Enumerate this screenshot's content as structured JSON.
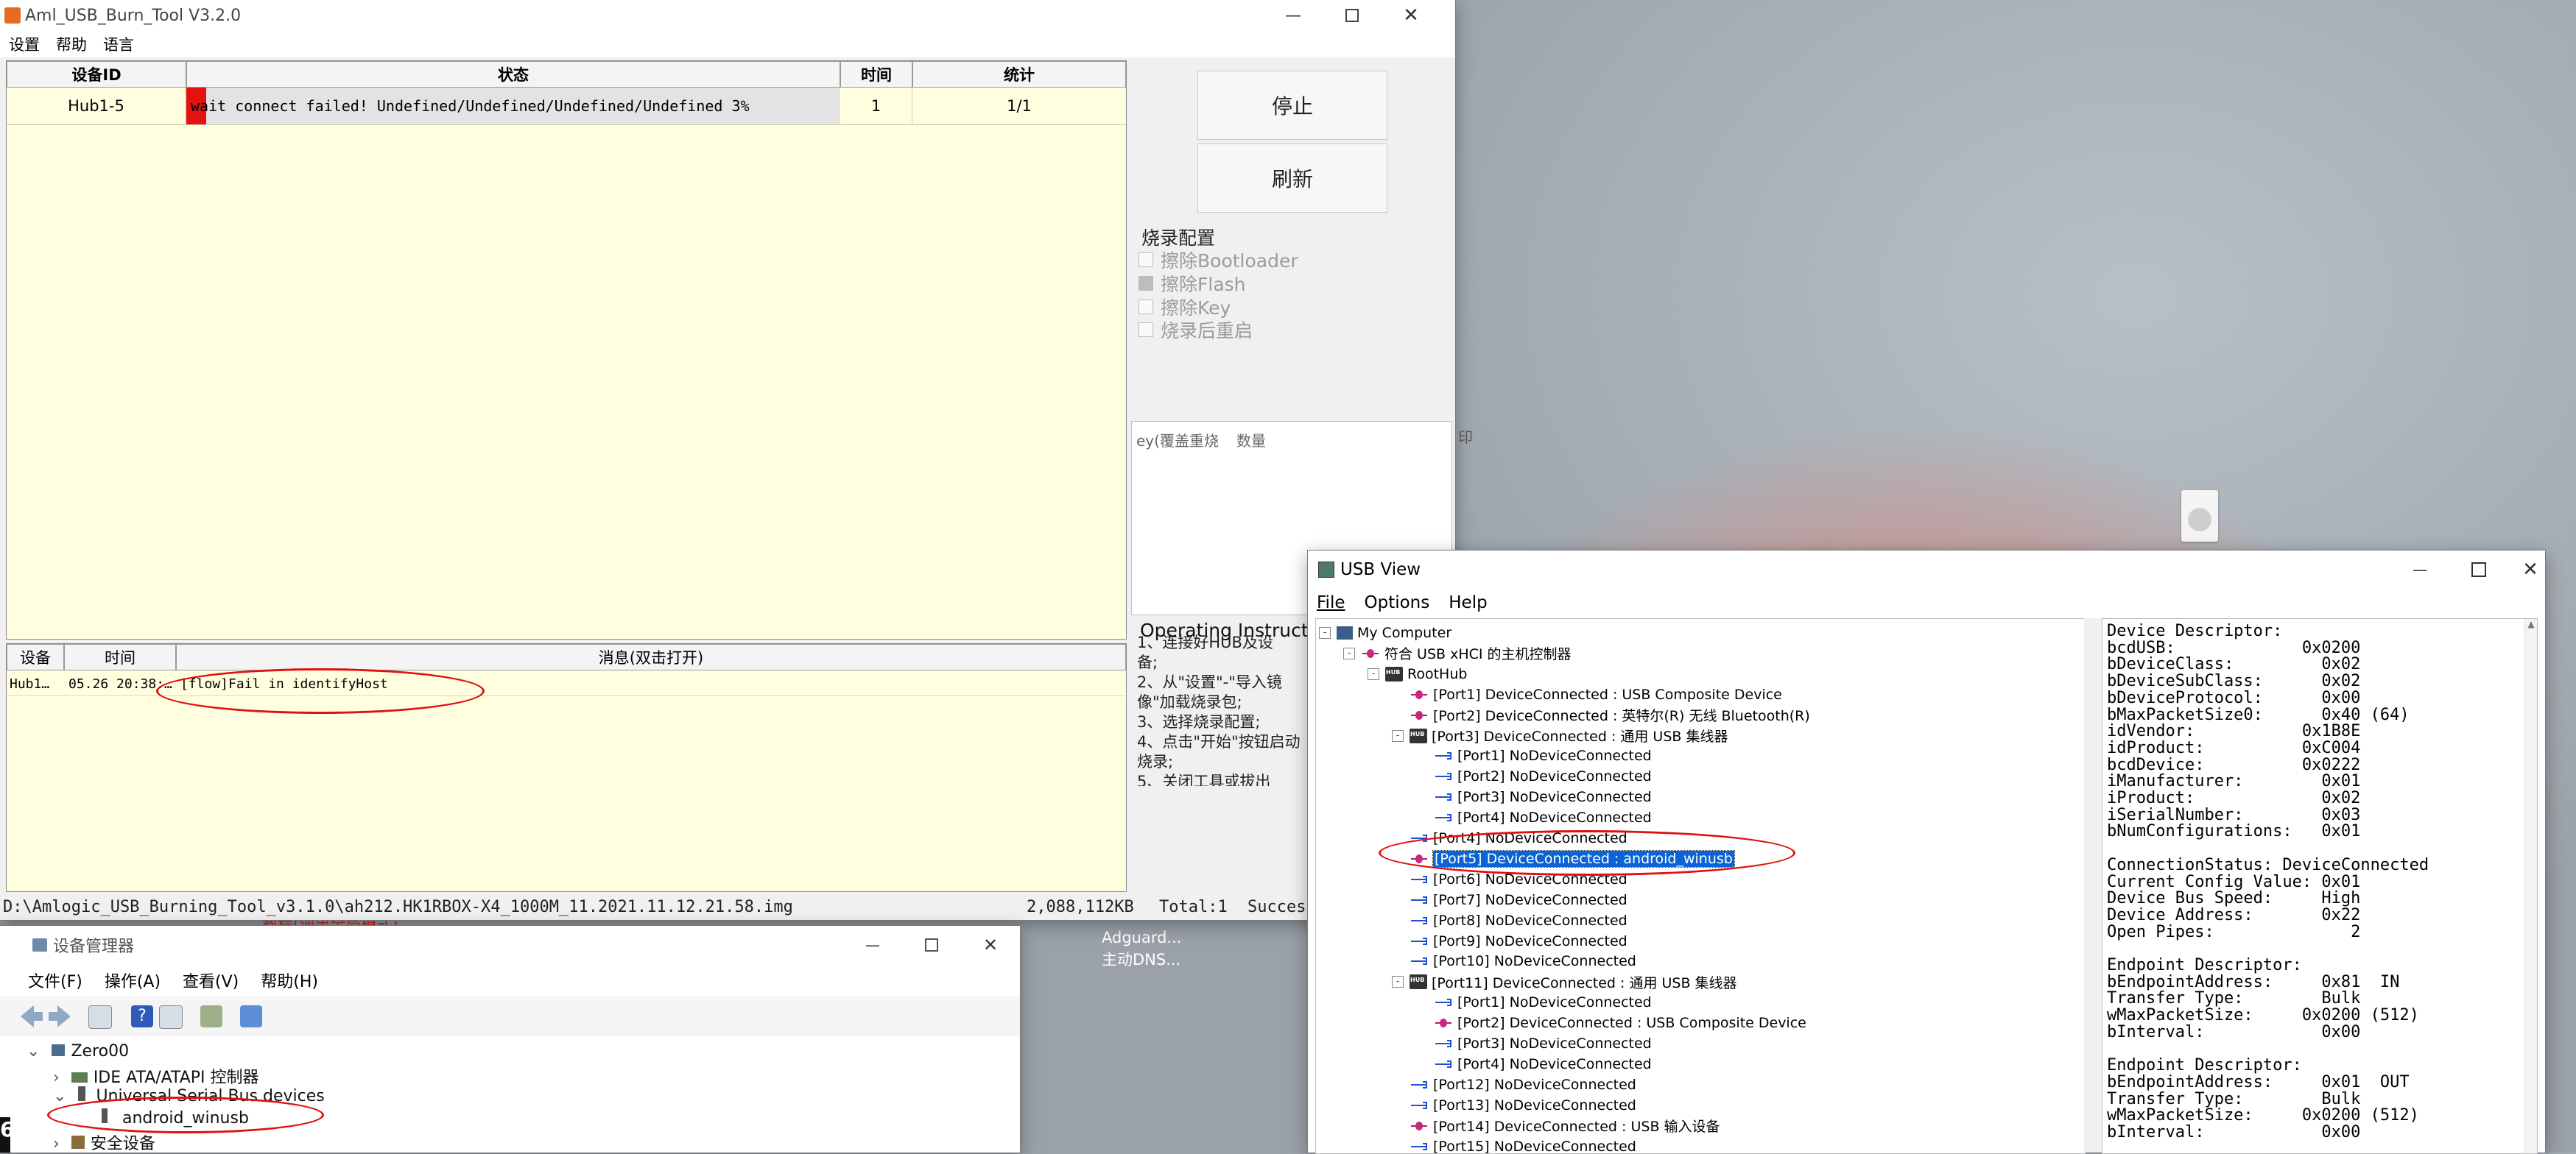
{
  "aml": {
    "title": "Aml_USB_Burn_Tool V3.2.0",
    "menu": [
      "设置",
      "帮助",
      "语言"
    ],
    "table": {
      "headers": [
        "设备ID",
        "状态",
        "时间",
        "统计"
      ],
      "rows": [
        {
          "device_id": "Hub1-5",
          "status": "wait connect failed! Undefined/Undefined/Undefined/Undefined 3%",
          "time": "1",
          "stats": "1/1"
        }
      ]
    },
    "buttons": {
      "stop": "停止",
      "refresh": "刷新"
    },
    "burn_config": {
      "title": "烧录配置",
      "options": [
        {
          "label": "擦除Bootloader",
          "checked": false
        },
        {
          "label": "擦除Flash",
          "checked": true
        },
        {
          "label": "擦除Key",
          "checked": false
        },
        {
          "label": "烧录后重启",
          "checked": false
        }
      ]
    },
    "key_table": {
      "headers": [
        "ey(覆盖重烧",
        "数量"
      ],
      "side_label": "印"
    },
    "instructions": {
      "title": "Operating Instructio",
      "lines": [
        "1、连接好HUB及设",
        "备;",
        "2、从\"设置\"-\"导入镜",
        "像\"加载烧录包;",
        "3、选择烧录配置;",
        "4、点击\"开始\"按钮启动",
        "烧录;",
        "5、关闭工具或拔出"
      ]
    },
    "log": {
      "headers": [
        "设备",
        "时间",
        "消息(双击打开)"
      ],
      "rows": [
        {
          "device": "Hub1…",
          "time": "05.26 20:38:…",
          "message": "[flow]Fail in identifyHost"
        }
      ]
    },
    "statusbar": {
      "path": "D:\\Amlogic_USB_Burning_Tool_v3.1.0\\ah212.HK1RBOX-X4_1000M_11.2021.11.12.21.58.img",
      "size": "2,088,112KB",
      "total": "Total:1",
      "success": "Succes"
    }
  },
  "desktop": {
    "overlap_text": [
      "教程(调出全局模式)",
      "Adguard...",
      "主动DNS..."
    ]
  },
  "devmgr": {
    "title": "设备管理器",
    "menu": [
      "文件(F)",
      "操作(A)",
      "查看(V)",
      "帮助(H)"
    ],
    "tree": [
      {
        "label": "Zero00",
        "level": 0,
        "expander": "v"
      },
      {
        "label": "IDE ATA/ATAPI 控制器",
        "level": 1,
        "expander": ">"
      },
      {
        "label": "Universal Serial Bus devices",
        "level": 1,
        "expander": "v"
      },
      {
        "label": "android_winusb",
        "level": 2,
        "expander": ""
      },
      {
        "label": "安全设备",
        "level": 1,
        "expander": ">"
      }
    ],
    "left_edge_char": "6"
  },
  "usbview": {
    "title": "USB View",
    "menu": [
      "File",
      "Options",
      "Help"
    ],
    "tree": [
      {
        "label": "My Computer",
        "level": 0,
        "icon": "computer",
        "expander": "-"
      },
      {
        "label": "符合 USB xHCI 的主机控制器",
        "level": 1,
        "icon": "pink",
        "expander": "-"
      },
      {
        "label": "RootHub",
        "level": 2,
        "icon": "hub",
        "expander": "-"
      },
      {
        "label": "[Port1] DeviceConnected : USB Composite Device",
        "level": 3,
        "icon": "pink"
      },
      {
        "label": "[Port2] DeviceConnected : 英特尔(R) 无线 Bluetooth(R)",
        "level": 3,
        "icon": "pink"
      },
      {
        "label": "[Port3] DeviceConnected : 通用 USB 集线器",
        "level": 3,
        "icon": "hub",
        "expander": "-"
      },
      {
        "label": "[Port1] NoDeviceConnected",
        "level": 4,
        "icon": "blue"
      },
      {
        "label": "[Port2] NoDeviceConnected",
        "level": 4,
        "icon": "blue"
      },
      {
        "label": "[Port3] NoDeviceConnected",
        "level": 4,
        "icon": "blue"
      },
      {
        "label": "[Port4] NoDeviceConnected",
        "level": 4,
        "icon": "blue"
      },
      {
        "label": "[Port4] NoDeviceConnected",
        "level": 3,
        "icon": "blue"
      },
      {
        "label": "[Port5] DeviceConnected : android_winusb",
        "level": 3,
        "icon": "pink",
        "selected": true
      },
      {
        "label": "[Port6] NoDeviceConnected",
        "level": 3,
        "icon": "blue"
      },
      {
        "label": "[Port7] NoDeviceConnected",
        "level": 3,
        "icon": "blue"
      },
      {
        "label": "[Port8] NoDeviceConnected",
        "level": 3,
        "icon": "blue"
      },
      {
        "label": "[Port9] NoDeviceConnected",
        "level": 3,
        "icon": "blue"
      },
      {
        "label": "[Port10] NoDeviceConnected",
        "level": 3,
        "icon": "blue"
      },
      {
        "label": "[Port11] DeviceConnected : 通用 USB 集线器",
        "level": 3,
        "icon": "hub",
        "expander": "-"
      },
      {
        "label": "[Port1] NoDeviceConnected",
        "level": 4,
        "icon": "blue"
      },
      {
        "label": "[Port2] DeviceConnected : USB Composite Device",
        "level": 4,
        "icon": "pink"
      },
      {
        "label": "[Port3] NoDeviceConnected",
        "level": 4,
        "icon": "blue"
      },
      {
        "label": "[Port4] NoDeviceConnected",
        "level": 4,
        "icon": "blue"
      },
      {
        "label": "[Port12] NoDeviceConnected",
        "level": 3,
        "icon": "blue"
      },
      {
        "label": "[Port13] NoDeviceConnected",
        "level": 3,
        "icon": "blue"
      },
      {
        "label": "[Port14] DeviceConnected : USB 输入设备",
        "level": 3,
        "icon": "pink"
      },
      {
        "label": "[Port15] NoDeviceConnected",
        "level": 3,
        "icon": "blue"
      }
    ],
    "details": "Device Descriptor:\nbcdUSB:             0x0200\nbDeviceClass:         0x02\nbDeviceSubClass:      0x02\nbDeviceProtocol:      0x00\nbMaxPacketSize0:      0x40 (64)\nidVendor:           0x1B8E\nidProduct:          0xC004\nbcdDevice:          0x0222\niManufacturer:        0x01\niProduct:             0x02\niSerialNumber:        0x03\nbNumConfigurations:   0x01\n\nConnectionStatus: DeviceConnected\nCurrent Config Value: 0x01\nDevice Bus Speed:     High\nDevice Address:       0x22\nOpen Pipes:              2\n\nEndpoint Descriptor:\nbEndpointAddress:     0x81  IN\nTransfer Type:        Bulk\nwMaxPacketSize:     0x0200 (512)\nbInterval:            0x00\n\nEndpoint Descriptor:\nbEndpointAddress:     0x01  OUT\nTransfer Type:        Bulk\nwMaxPacketSize:     0x0200 (512)\nbInterval:            0x00"
  }
}
